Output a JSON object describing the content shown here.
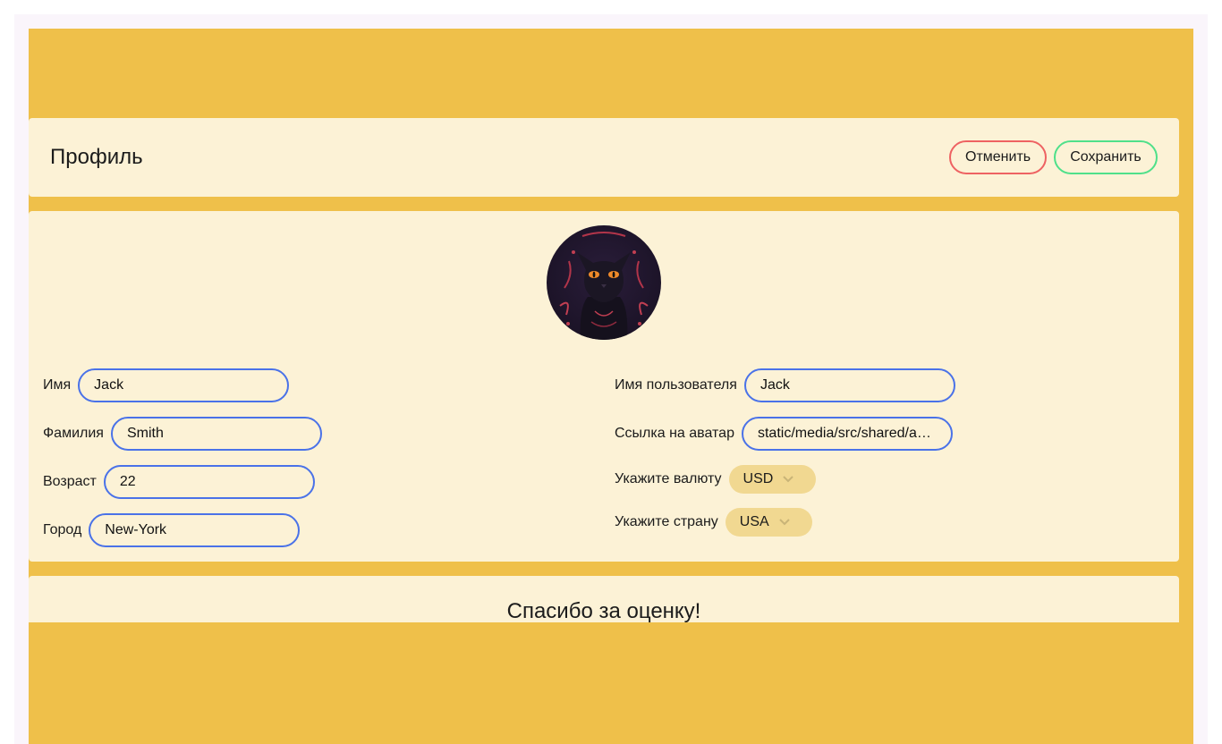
{
  "header": {
    "title": "Профиль",
    "cancel_label": "Отменить",
    "save_label": "Сохранить"
  },
  "profile": {
    "first_name": {
      "label": "Имя",
      "value": "Jack"
    },
    "last_name": {
      "label": "Фамилия",
      "value": "Smith"
    },
    "age": {
      "label": "Возраст",
      "value": "22"
    },
    "city": {
      "label": "Город",
      "value": "New-York"
    },
    "username": {
      "label": "Имя пользователя",
      "value": "Jack"
    },
    "avatar_link": {
      "label": "Ссылка на аватар",
      "value": "static/media/src/shared/assets/..."
    },
    "currency": {
      "label": "Укажите валюту",
      "value": "USD"
    },
    "country": {
      "label": "Укажите страну",
      "value": "USA"
    }
  },
  "rating": {
    "title": "Спасибо за оценку!"
  },
  "colors": {
    "app_background": "#efc04a",
    "card_background": "#fcf2d6",
    "input_border": "#4a72e8",
    "cancel_border": "#ee6262",
    "save_border": "#4fe08a",
    "select_background": "#f1d891"
  },
  "icons": {
    "avatar": "black-cat-avatar",
    "select_chevron": "chevron-down-icon"
  }
}
